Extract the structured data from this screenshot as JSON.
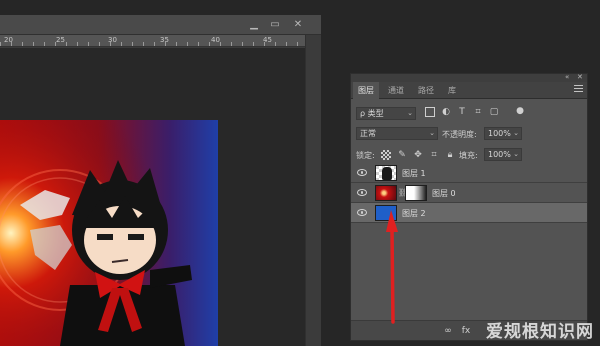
{
  "document": {
    "ruler_ticks": [
      "20",
      "25",
      "30",
      "35",
      "40",
      "45"
    ],
    "window_buttons": {
      "minimize": "▁",
      "maximize": "▭",
      "close": "✕"
    }
  },
  "layers_panel": {
    "collapse_label": "«",
    "close_label": "✕",
    "tabs": [
      "图层",
      "通道",
      "路径",
      "库"
    ],
    "filter": {
      "label": "ρ 类型",
      "chevron": "⌄"
    },
    "blend_mode": {
      "value": "正常",
      "chevron": "⌄"
    },
    "opacity": {
      "label": "不透明度:",
      "value": "100%",
      "chevron": "⌄"
    },
    "lock": {
      "label": "锁定:"
    },
    "fill": {
      "label": "填充:",
      "value": "100%",
      "chevron": "⌄"
    },
    "layers": [
      {
        "name": "图层 1",
        "selected": false,
        "has_mask": false
      },
      {
        "name": "图层 0",
        "selected": false,
        "has_mask": true
      },
      {
        "name": "图层 2",
        "selected": true,
        "has_mask": false
      }
    ],
    "colors": {
      "layer2_fill": "#1f5fc8",
      "arrow": "#e02020",
      "selection": "#686868"
    }
  },
  "watermark": {
    "text": "爱规根知识网"
  }
}
